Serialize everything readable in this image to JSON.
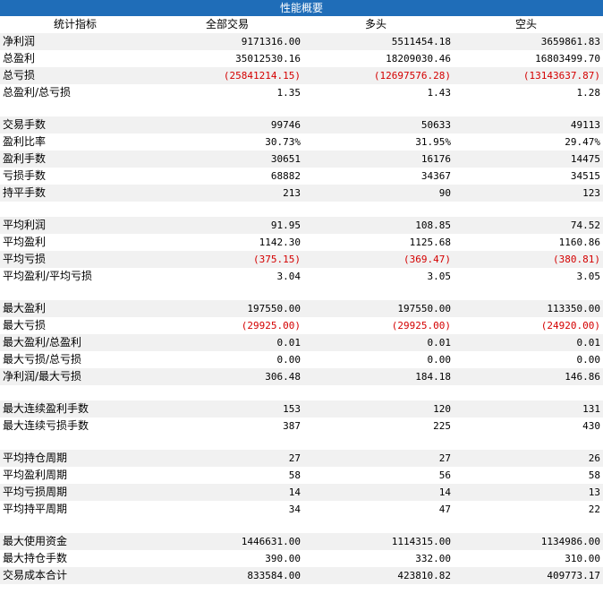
{
  "title": "性能概要",
  "headers": [
    "统计指标",
    "全部交易",
    "多头",
    "空头"
  ],
  "colors": {
    "title_bg": "#1f6db8",
    "negative": "#d40000",
    "shade": "#f1f1f1"
  },
  "rows": [
    {
      "label": "净利润",
      "v": [
        "9171316.00",
        "5511454.18",
        "3659861.83"
      ]
    },
    {
      "label": "总盈利",
      "v": [
        "35012530.16",
        "18209030.46",
        "16803499.70"
      ]
    },
    {
      "label": "总亏损",
      "v": [
        "(25841214.15)",
        "(12697576.28)",
        "(13143637.87)"
      ],
      "neg": true
    },
    {
      "label": "总盈利/总亏损",
      "v": [
        "1.35",
        "1.43",
        "1.28"
      ]
    },
    {
      "spacer": true
    },
    {
      "label": "交易手数",
      "v": [
        "99746",
        "50633",
        "49113"
      ]
    },
    {
      "label": "盈利比率",
      "v": [
        "30.73%",
        "31.95%",
        "29.47%"
      ]
    },
    {
      "label": "盈利手数",
      "v": [
        "30651",
        "16176",
        "14475"
      ]
    },
    {
      "label": "亏损手数",
      "v": [
        "68882",
        "34367",
        "34515"
      ]
    },
    {
      "label": "持平手数",
      "v": [
        "213",
        "90",
        "123"
      ]
    },
    {
      "spacer": true
    },
    {
      "label": "平均利润",
      "v": [
        "91.95",
        "108.85",
        "74.52"
      ]
    },
    {
      "label": "平均盈利",
      "v": [
        "1142.30",
        "1125.68",
        "1160.86"
      ]
    },
    {
      "label": "平均亏损",
      "v": [
        "(375.15)",
        "(369.47)",
        "(380.81)"
      ],
      "neg": true
    },
    {
      "label": "平均盈利/平均亏损",
      "v": [
        "3.04",
        "3.05",
        "3.05"
      ]
    },
    {
      "spacer": true
    },
    {
      "label": "最大盈利",
      "v": [
        "197550.00",
        "197550.00",
        "113350.00"
      ]
    },
    {
      "label": "最大亏损",
      "v": [
        "(29925.00)",
        "(29925.00)",
        "(24920.00)"
      ],
      "neg": true
    },
    {
      "label": "最大盈利/总盈利",
      "v": [
        "0.01",
        "0.01",
        "0.01"
      ]
    },
    {
      "label": "最大亏损/总亏损",
      "v": [
        "0.00",
        "0.00",
        "0.00"
      ]
    },
    {
      "label": "净利润/最大亏损",
      "v": [
        "306.48",
        "184.18",
        "146.86"
      ]
    },
    {
      "spacer": true
    },
    {
      "label": "最大连续盈利手数",
      "v": [
        "153",
        "120",
        "131"
      ]
    },
    {
      "label": "最大连续亏损手数",
      "v": [
        "387",
        "225",
        "430"
      ]
    },
    {
      "spacer": true
    },
    {
      "label": "平均持仓周期",
      "v": [
        "27",
        "27",
        "26"
      ]
    },
    {
      "label": "平均盈利周期",
      "v": [
        "58",
        "56",
        "58"
      ]
    },
    {
      "label": "平均亏损周期",
      "v": [
        "14",
        "14",
        "13"
      ]
    },
    {
      "label": "平均持平周期",
      "v": [
        "34",
        "47",
        "22"
      ]
    },
    {
      "spacer": true
    },
    {
      "label": "最大使用资金",
      "v": [
        "1446631.00",
        "1114315.00",
        "1134986.00"
      ]
    },
    {
      "label": "最大持仓手数",
      "v": [
        "390.00",
        "332.00",
        "310.00"
      ]
    },
    {
      "label": "交易成本合计",
      "v": [
        "833584.00",
        "423810.82",
        "409773.17"
      ]
    }
  ]
}
